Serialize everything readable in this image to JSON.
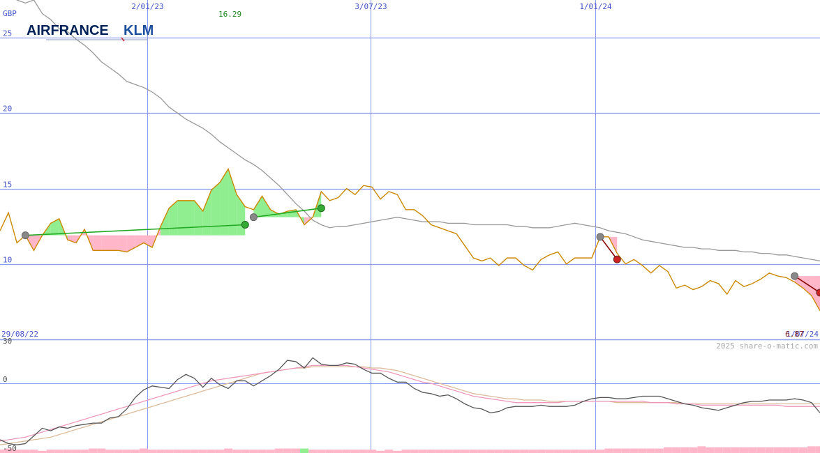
{
  "chart_data": {
    "type": "line",
    "currency": "GBP",
    "company": "AIRFRANCE",
    "company_suffix": "KLM",
    "start_date": "29/08/22",
    "end_date": "1/07/24",
    "high_label": "16.29",
    "last_price": "6.87",
    "copyright": "2025 share-o-matic.com",
    "x_ticks": [
      "2/01/23",
      "3/07/23",
      "1/01/24"
    ],
    "y_ticks": [
      10,
      15,
      20,
      25
    ],
    "ylim": [
      5,
      27.5
    ],
    "osc_ticks": [
      "30",
      "0",
      "-50"
    ],
    "osc_ylim": [
      -50,
      30
    ],
    "colors": {
      "price": "#cc8800",
      "trend": "#999999",
      "gain_fill": "#90ee90",
      "loss_fill": "#ffb6c8",
      "buy_line": "#22aa22",
      "sell_line": "#880000",
      "grid": "#8899ee",
      "osc_main": "#555555",
      "osc_pink": "#ee99bb",
      "osc_tan": "#ddbb99",
      "volume": "#ffb6c8",
      "axis_text": "#4455cc",
      "high_text": "#228822",
      "last_text": "#882222",
      "logo_blue": "#002157",
      "logo_light": "#1b4fa0"
    },
    "price": [
      12.2,
      13.4,
      11.4,
      11.9,
      10.9,
      11.9,
      12.7,
      13.0,
      11.6,
      11.4,
      12.3,
      10.9,
      10.9,
      10.9,
      10.9,
      10.8,
      11.1,
      11.4,
      11.1,
      12.5,
      13.7,
      14.2,
      14.2,
      14.2,
      13.5,
      14.9,
      15.4,
      16.3,
      14.6,
      13.8,
      13.6,
      14.5,
      13.6,
      13.3,
      13.5,
      13.6,
      12.6,
      13.1,
      14.8,
      14.2,
      14.4,
      15.0,
      14.6,
      15.2,
      15.1,
      14.3,
      14.8,
      14.6,
      13.6,
      13.6,
      13.2,
      12.6,
      12.4,
      12.2,
      12.0,
      11.2,
      10.4,
      10.2,
      10.4,
      9.9,
      10.4,
      10.4,
      9.9,
      9.6,
      10.3,
      10.6,
      10.8,
      10.0,
      10.4,
      10.4,
      10.4,
      11.8,
      11.8,
      10.7,
      10.0,
      10.3,
      9.9,
      9.4,
      9.9,
      9.5,
      8.4,
      8.6,
      8.3,
      8.5,
      8.9,
      8.7,
      8.0,
      8.9,
      8.5,
      8.7,
      9.0,
      9.4,
      9.2,
      9.1,
      8.8,
      8.4,
      7.9,
      6.9
    ],
    "trend": [
      28.2,
      28.0,
      27.5,
      27.3,
      27.5,
      26.6,
      26.2,
      25.6,
      25.4,
      24.9,
      24.5,
      24.0,
      23.4,
      23.0,
      22.6,
      22.1,
      21.9,
      21.7,
      21.4,
      21.0,
      20.4,
      20.0,
      19.6,
      19.3,
      19.0,
      18.6,
      18.1,
      17.7,
      17.3,
      16.9,
      16.6,
      16.2,
      15.7,
      15.2,
      14.6,
      14.0,
      13.5,
      12.9,
      12.6,
      12.4,
      12.5,
      12.5,
      12.6,
      12.7,
      12.8,
      12.9,
      13.0,
      13.1,
      13.0,
      12.9,
      12.8,
      12.8,
      12.8,
      12.7,
      12.7,
      12.7,
      12.6,
      12.6,
      12.6,
      12.6,
      12.6,
      12.5,
      12.5,
      12.4,
      12.4,
      12.4,
      12.5,
      12.6,
      12.7,
      12.6,
      12.5,
      12.4,
      12.2,
      12.1,
      12.0,
      11.8,
      11.6,
      11.5,
      11.4,
      11.3,
      11.2,
      11.1,
      11.1,
      11.0,
      11.0,
      10.9,
      10.9,
      10.9,
      10.8,
      10.8,
      10.7,
      10.7,
      10.6,
      10.6,
      10.5,
      10.4,
      10.3,
      10.2
    ],
    "osc_main": [
      -44,
      -47,
      -48,
      -47,
      -41,
      -35,
      -37,
      -34,
      -35,
      -33,
      -32,
      -31,
      -31,
      -27,
      -26,
      -20,
      -11,
      -5,
      -2,
      -3,
      -4,
      3,
      7,
      4,
      -3,
      4,
      -1,
      -4,
      2,
      2,
      -2,
      2,
      6,
      11,
      18,
      17,
      12,
      20,
      15,
      14,
      14,
      16,
      15,
      11,
      8,
      8,
      4,
      1,
      1,
      -4,
      -7,
      -8,
      -10,
      -9,
      -12,
      -16,
      -19,
      -20,
      -23,
      -22,
      -19,
      -18,
      -18,
      -18,
      -17,
      -18,
      -18,
      -18,
      -17,
      -14,
      -12,
      -11,
      -11,
      -12,
      -12,
      -11,
      -10,
      -10,
      -10,
      -12,
      -14,
      -16,
      -17,
      -19,
      -20,
      -21,
      -19,
      -17,
      -15,
      -14,
      -14,
      -13,
      -13,
      -13,
      -12,
      -13,
      -15,
      -23
    ],
    "osc_pink": [
      -45,
      -44,
      -43,
      -42,
      -40,
      -38,
      -36,
      -34,
      -32,
      -30,
      -28,
      -26,
      -24,
      -22,
      -20,
      -18,
      -16,
      -14,
      -12,
      -10,
      -8,
      -6,
      -4,
      -2,
      0,
      2,
      3,
      4,
      5,
      6,
      7,
      8,
      9,
      10,
      11,
      12,
      13,
      14,
      14,
      14,
      14,
      14,
      13,
      12,
      11,
      10,
      9,
      7,
      5,
      3,
      1,
      0,
      -2,
      -4,
      -6,
      -8,
      -10,
      -11,
      -12,
      -13,
      -14,
      -15,
      -15,
      -15,
      -15,
      -15,
      -15,
      -14,
      -14,
      -14,
      -14,
      -14,
      -14,
      -14,
      -14,
      -14,
      -14,
      -15,
      -15,
      -15,
      -16,
      -16,
      -16,
      -17,
      -17,
      -17,
      -17,
      -17,
      -17,
      -17,
      -17,
      -17,
      -17,
      -18,
      -18,
      -18,
      -18,
      -18
    ],
    "osc_tan": [
      -48,
      -47,
      -46,
      -45,
      -44,
      -43,
      -42,
      -40,
      -38,
      -36,
      -34,
      -32,
      -30,
      -28,
      -26,
      -24,
      -22,
      -20,
      -18,
      -16,
      -14,
      -12,
      -10,
      -8,
      -6,
      -4,
      -2,
      0,
      2,
      4,
      6,
      8,
      9,
      10,
      11,
      12,
      12,
      13,
      13,
      13,
      13,
      13,
      13,
      13,
      12,
      12,
      11,
      10,
      8,
      6,
      4,
      2,
      0,
      -2,
      -4,
      -6,
      -8,
      -9,
      -10,
      -11,
      -12,
      -12,
      -13,
      -13,
      -13,
      -14,
      -14,
      -14,
      -14,
      -14,
      -14,
      -14,
      -14,
      -15,
      -15,
      -15,
      -15,
      -15,
      -15,
      -15,
      -15,
      -16,
      -16,
      -16,
      -16,
      -16,
      -16,
      -16,
      -16,
      -16,
      -16,
      -16,
      -16,
      -16,
      -16,
      -16,
      -16,
      -16
    ],
    "volume": [
      3,
      4,
      3,
      3,
      3,
      2,
      3,
      3,
      3,
      3,
      3,
      4,
      4,
      3,
      3,
      3,
      3,
      4,
      3,
      3,
      3,
      3,
      3,
      3,
      3,
      3,
      3,
      4,
      3,
      3,
      3,
      3,
      3,
      4,
      4,
      4,
      4,
      3,
      3,
      3,
      3,
      3,
      3,
      3,
      3,
      2,
      3,
      2,
      3,
      3,
      3,
      3,
      3,
      3,
      3,
      3,
      3,
      3,
      3,
      3,
      3,
      3,
      3,
      3,
      3,
      3,
      3,
      3,
      3,
      3,
      3,
      3,
      4,
      4,
      4,
      4,
      4,
      4,
      4,
      5,
      5,
      5,
      5,
      6,
      5,
      5,
      5,
      5,
      5,
      5,
      5,
      5,
      5,
      5,
      5,
      5,
      6,
      6
    ],
    "volume_green_index": 36,
    "trades": [
      {
        "entry_index": 3,
        "exit_index": 29,
        "entry_price": 11.9,
        "exit_price": 12.6,
        "result": "gain"
      },
      {
        "entry_index": 30,
        "exit_index": 38,
        "entry_price": 13.1,
        "exit_price": 13.7,
        "result": "gain"
      },
      {
        "entry_index": 71,
        "exit_index": 73,
        "entry_price": 11.8,
        "exit_price": 10.3,
        "result": "loss"
      },
      {
        "entry_index": 94,
        "exit_index": 97,
        "entry_price": 9.2,
        "exit_price": 8.1,
        "result": "loss"
      }
    ]
  }
}
